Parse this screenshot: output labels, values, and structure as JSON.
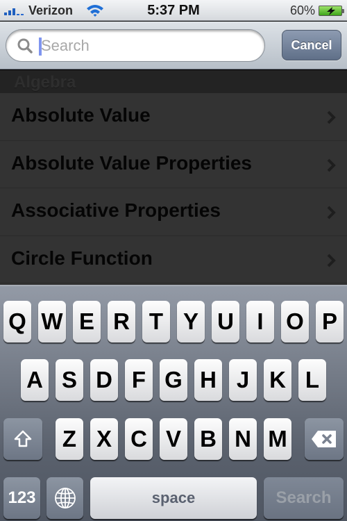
{
  "status_bar": {
    "carrier": "Verizon",
    "signal_bars": 3,
    "signal_bars_total": 5,
    "wifi_icon": "wifi-icon",
    "time": "5:37 PM",
    "battery_percent": "60%",
    "battery_level": 0.6,
    "battery_charging": true
  },
  "search_bar": {
    "placeholder": "Search",
    "value": "",
    "cancel_label": "Cancel"
  },
  "list": {
    "section_title": "Algebra",
    "items": [
      {
        "label": "Absolute Value"
      },
      {
        "label": "Absolute Value Properties"
      },
      {
        "label": "Associative Properties"
      },
      {
        "label": "Circle Function"
      }
    ]
  },
  "keyboard": {
    "row1": [
      "Q",
      "W",
      "E",
      "R",
      "T",
      "Y",
      "U",
      "I",
      "O",
      "P"
    ],
    "row2": [
      "A",
      "S",
      "D",
      "F",
      "G",
      "H",
      "J",
      "K",
      "L"
    ],
    "row3": [
      "Z",
      "X",
      "C",
      "V",
      "B",
      "N",
      "M"
    ],
    "shift_icon": "shift-icon",
    "backspace_icon": "backspace-icon",
    "numbers_label": "123",
    "globe_icon": "globe-icon",
    "space_label": "space",
    "return_label": "Search",
    "colors": {
      "accent_caret": "#7f95ef",
      "cancel_button": "#6f7f97"
    }
  }
}
